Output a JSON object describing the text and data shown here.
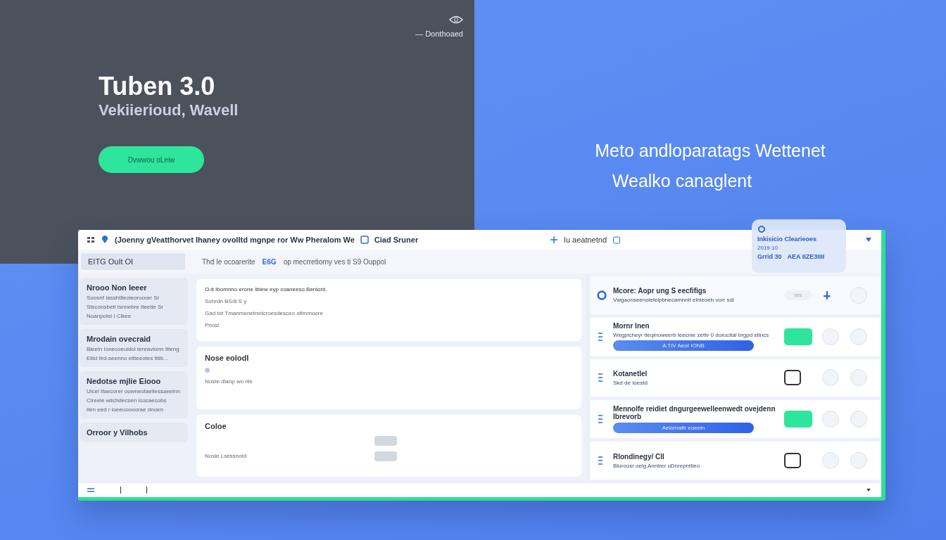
{
  "hero": {
    "top_link": "— Donthoaed",
    "title": "Tuben 3.0",
    "subtitle": "Vekiierioud, Wavell",
    "cta": "Dvwwou oLeiw"
  },
  "tagline": [
    "Meto andloparatags Wettenet",
    "Wealko canaglent"
  ],
  "app": {
    "title": "(Joenny gVeatthorvet Ihaney ovolItd mgnpe ror Ww Pheralom  We",
    "title_tag": "Ciad Sruner",
    "title_right": "Iu aeatnetnd",
    "toolbar": {
      "chip": "EITG  OuIt OI",
      "hint": "Thd Ie ocoarerite",
      "link": "E6G",
      "text": "op mecrretiorny ves ti S9 Ouppol"
    },
    "overlay": {
      "title": "Inkisicio Clearieoes",
      "date": "2019 10",
      "left": "Grrid 30",
      "right": "AEA IIZE3IIII"
    },
    "sidebar": [
      {
        "title": "Nrooo Non Ieeer",
        "lines": [
          "Soosnf Iasshtlleoleorooorr Sr",
          "Stsconsbetl Isnnebre Iteetie Sr",
          "Noanpotsl I Clkee"
        ]
      },
      {
        "title": "Mrodain ovecraid",
        "lines": [
          "Bleeln Ionecoeuidol tereavionn Itteng",
          "Eliid Ilrd-seenno eitteeotes titib..."
        ]
      },
      {
        "title": "Nedotse mjlie Eiooo",
        "lines": [
          "Ulcel Ifaecorer ouwneotaeilessaeeinn",
          "Cireele wiichdecsen icocaecobs",
          "Ilen eed r ioeeuoooorae dnoen"
        ]
      },
      {
        "title": "Orroor y Vilhobs"
      }
    ],
    "panels": [
      {
        "kind": "text",
        "title": "O-ti Ibomnno erone Ibiew eyp coaneeso Beniont.",
        "lines": [
          "Sohrdn BS/8 S y",
          "Gad tot Tmanmenetredcroesdesceo ofimmoore"
        ],
        "note": "Pnosl"
      },
      {
        "kind": "dot",
        "title": "Nose eolodl",
        "lines": [
          "Noste dlanp wo rils"
        ]
      },
      {
        "kind": "buttons",
        "title": "Coloe",
        "lines": [
          "Nosle Lsessnotd"
        ]
      }
    ],
    "rows": [
      {
        "kind": "header",
        "title": "Mcore: Aopr ung S  eecfifigs",
        "desc": "Vwgaonseenolelelpbnecamnnit elnleoeb vorr sdi",
        "chip": "ses"
      },
      {
        "kind": "item",
        "title": "Mornr Inen",
        "desc": "Wegpicheyr tieqinoweerb ieecnie zettv 0 dorucital brgpd eitncs",
        "action": "A TIV AeoI IONB",
        "active": true
      },
      {
        "kind": "item",
        "title": "Kotanetlel",
        "desc": "Skd de Ioestd",
        "active": false
      },
      {
        "kind": "item",
        "title": "Mennolfe reidiet dngurgeewelleenwedt ovejdenn Ibrevorb",
        "action": "Aeiomattr eoeeln",
        "active": true
      },
      {
        "kind": "item",
        "title": "Rlondinegy/ Cll",
        "desc": "Bluroosr oelg Anntrer uDnrepnttieo",
        "active": false
      }
    ]
  }
}
